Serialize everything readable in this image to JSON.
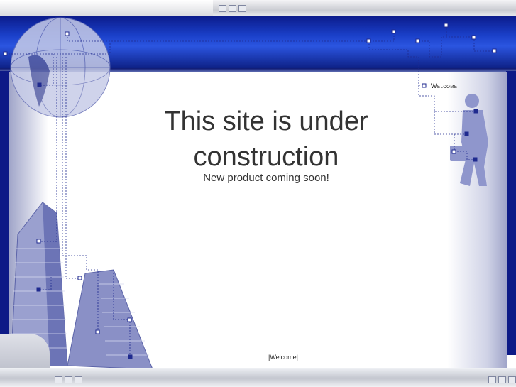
{
  "heading": {
    "line1": "This site is under",
    "line2": "construction"
  },
  "subheading": "New product coming soon!",
  "nav": {
    "top_welcome": "Welcome",
    "bottom_welcome": "|Welcome|"
  },
  "colors": {
    "band": "#1a3fc8",
    "text": "#333333",
    "accent": "#0d1a87"
  }
}
